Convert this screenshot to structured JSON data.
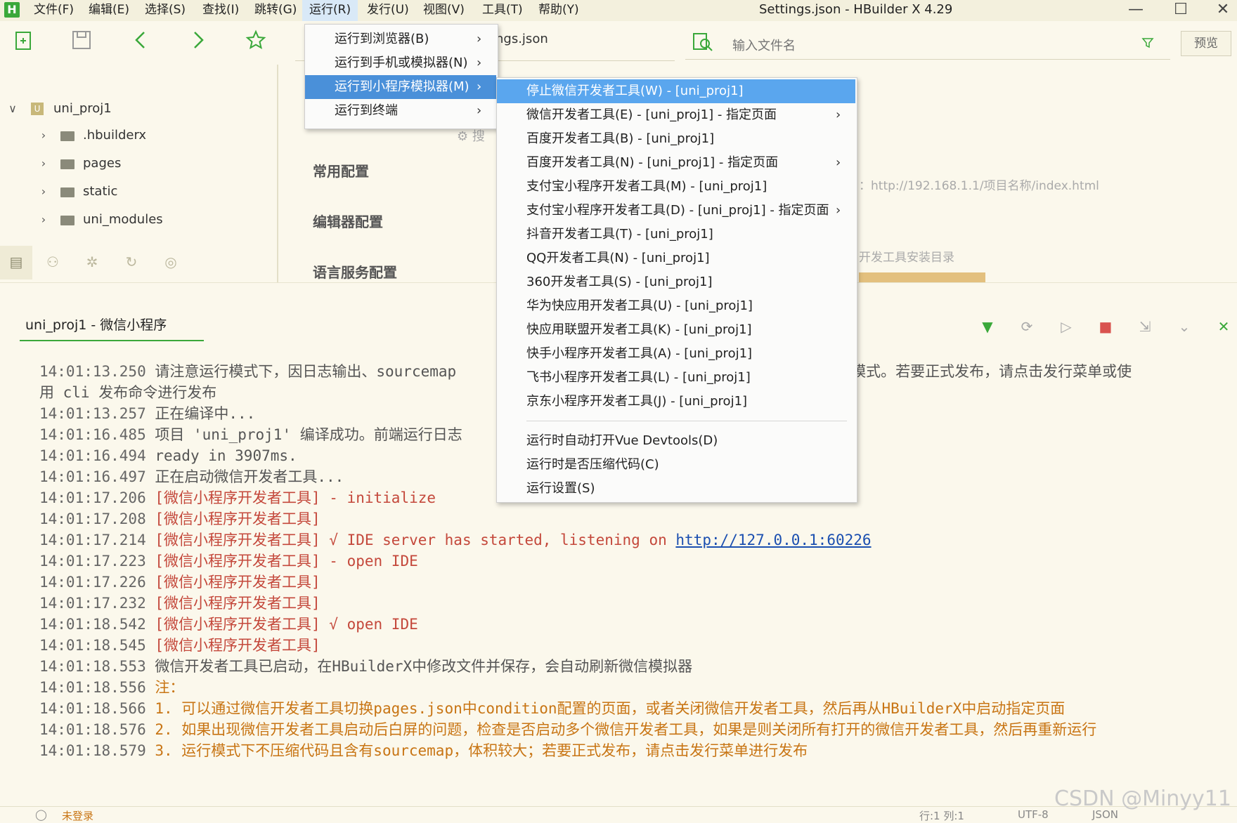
{
  "app": {
    "logo": "H",
    "window_title": "Settings.json - HBuilder X 4.29"
  },
  "menubar": [
    {
      "label": "文件(F)"
    },
    {
      "label": "编辑(E)"
    },
    {
      "label": "选择(S)"
    },
    {
      "label": "查找(I)"
    },
    {
      "label": "跳转(G)"
    },
    {
      "label": "运行(R)"
    },
    {
      "label": "发行(U)"
    },
    {
      "label": "视图(V)"
    },
    {
      "label": "工具(T)"
    },
    {
      "label": "帮助(Y)"
    }
  ],
  "window_buttons": {
    "minimize": "—",
    "maximize": "☐",
    "close": "✕"
  },
  "toolbar": {
    "file_tab": "ngs.json",
    "search_placeholder": "输入文件名",
    "preview_label": "预览"
  },
  "tree": {
    "root": "uni_proj1",
    "children": [
      ".hbuilderx",
      "pages",
      "static",
      "uni_modules"
    ]
  },
  "settings": {
    "sections": [
      "常用配置",
      "编辑器配置",
      "语言服务配置"
    ],
    "search_fragment": "搜",
    "url_hint": "：http://192.168.1.1/项目名称/index.html",
    "devdir_hint": "开发工具安装目录"
  },
  "run_menu": {
    "items": [
      {
        "label": "运行到浏览器(B)"
      },
      {
        "label": "运行到手机或模拟器(N)"
      },
      {
        "label": "运行到小程序模拟器(M)"
      },
      {
        "label": "运行到终端"
      }
    ]
  },
  "submenu": {
    "items": [
      {
        "label": "停止微信开发者工具(W) - [uni_proj1]",
        "arrow": false
      },
      {
        "label": "微信开发者工具(E) - [uni_proj1] - 指定页面",
        "arrow": true
      },
      {
        "label": "百度开发者工具(B) - [uni_proj1]",
        "arrow": false
      },
      {
        "label": "百度开发者工具(N) - [uni_proj1] - 指定页面",
        "arrow": true
      },
      {
        "label": "支付宝小程序开发者工具(M) - [uni_proj1]",
        "arrow": false
      },
      {
        "label": "支付宝小程序开发者工具(D) - [uni_proj1] - 指定页面",
        "arrow": true
      },
      {
        "label": "抖音开发者工具(T) - [uni_proj1]",
        "arrow": false
      },
      {
        "label": "QQ开发者工具(N) - [uni_proj1]",
        "arrow": false
      },
      {
        "label": "360开发者工具(S) - [uni_proj1]",
        "arrow": false
      },
      {
        "label": "华为快应用开发者工具(U) - [uni_proj1]",
        "arrow": false
      },
      {
        "label": "快应用联盟开发者工具(K) - [uni_proj1]",
        "arrow": false
      },
      {
        "label": "快手小程序开发者工具(A) - [uni_proj1]",
        "arrow": false
      },
      {
        "label": "飞书小程序开发者工具(L) - [uni_proj1]",
        "arrow": false
      },
      {
        "label": "京东小程序开发者工具(J) - [uni_proj1]",
        "arrow": false
      }
    ],
    "extra": [
      {
        "label": "运行时自动打开Vue Devtools(D)"
      },
      {
        "label": "运行时是否压缩代码(C)"
      },
      {
        "label": "运行设置(S)"
      }
    ]
  },
  "console": {
    "tab_label": "uni_proj1 - 微信小程序",
    "lines": [
      {
        "ts": "14:01:13.250",
        "parts": [
          {
            "t": "请注意运行模式下，因日志输出、sourcemap",
            "c": "t-norm"
          },
          {
            "t": "发行模式。若要正式发布，请点击发行菜单或使",
            "c": "t-norm",
            "gap": true
          }
        ]
      },
      {
        "ts": "",
        "parts": [
          {
            "t": "用 cli 发布命令进行发布",
            "c": "t-norm"
          }
        ]
      },
      {
        "ts": "14:01:13.257",
        "parts": [
          {
            "t": "正在编译中...",
            "c": "t-norm"
          }
        ]
      },
      {
        "ts": "14:01:16.485",
        "parts": [
          {
            "t": "项目 'uni_proj1' 编译成功。前端运行日志",
            "c": "t-norm"
          }
        ]
      },
      {
        "ts": "14:01:16.494",
        "parts": [
          {
            "t": "ready in 3907ms.",
            "c": "t-norm"
          }
        ]
      },
      {
        "ts": "14:01:16.497",
        "parts": [
          {
            "t": "正在启动微信开发者工具...",
            "c": "t-norm"
          }
        ]
      },
      {
        "ts": "14:01:17.206",
        "parts": [
          {
            "t": "[微信小程序开发者工具] - initialize",
            "c": "t-red"
          }
        ]
      },
      {
        "ts": "14:01:17.208",
        "parts": [
          {
            "t": "[微信小程序开发者工具]",
            "c": "t-red"
          }
        ]
      },
      {
        "ts": "14:01:17.214",
        "parts": [
          {
            "t": "[微信小程序开发者工具] √ IDE server has started, listening on ",
            "c": "t-red"
          },
          {
            "t": "http://127.0.0.1:60226",
            "c": "t-link"
          }
        ]
      },
      {
        "ts": "14:01:17.223",
        "parts": [
          {
            "t": "[微信小程序开发者工具] - open IDE",
            "c": "t-red"
          }
        ]
      },
      {
        "ts": "14:01:17.226",
        "parts": [
          {
            "t": "[微信小程序开发者工具]",
            "c": "t-red"
          }
        ]
      },
      {
        "ts": "14:01:17.232",
        "parts": [
          {
            "t": "[微信小程序开发者工具]",
            "c": "t-red"
          }
        ]
      },
      {
        "ts": "14:01:18.542",
        "parts": [
          {
            "t": "[微信小程序开发者工具] √ open IDE",
            "c": "t-red"
          }
        ]
      },
      {
        "ts": "14:01:18.545",
        "parts": [
          {
            "t": "[微信小程序开发者工具]",
            "c": "t-red"
          }
        ]
      },
      {
        "ts": "14:01:18.553",
        "parts": [
          {
            "t": "微信开发者工具已启动，在HBuilderX中修改文件并保存，会自动刷新微信模拟器",
            "c": "t-norm"
          }
        ]
      },
      {
        "ts": "14:01:18.556",
        "parts": [
          {
            "t": "注：",
            "c": "t-orange"
          }
        ]
      },
      {
        "ts": "14:01:18.566",
        "parts": [
          {
            "t": "1. 可以通过微信开发者工具切换pages.json中condition配置的页面，或者关闭微信开发者工具，然后再从HBuilderX中启动指定页面",
            "c": "t-orange"
          }
        ]
      },
      {
        "ts": "14:01:18.576",
        "parts": [
          {
            "t": "2. 如果出现微信开发者工具启动后白屏的问题，检查是否启动多个微信开发者工具，如果是则关闭所有打开的微信开发者工具，然后再重新运行",
            "c": "t-orange"
          }
        ]
      },
      {
        "ts": "14:01:18.579",
        "parts": [
          {
            "t": "3. 运行模式下不压缩代码且含有sourcemap，体积较大；若要正式发布，请点击发行菜单进行发布",
            "c": "t-orange"
          }
        ]
      }
    ]
  },
  "status": {
    "login": "未登录",
    "row_col": "行:1   列:1",
    "encoding": "UTF-8",
    "lang": "JSON"
  },
  "watermark": "CSDN @Minyy11",
  "colors": {
    "accent": "#3aa83a",
    "menu_highlight": "#5aa6ee",
    "log_red": "#c4483b",
    "log_orange": "#c87514"
  }
}
